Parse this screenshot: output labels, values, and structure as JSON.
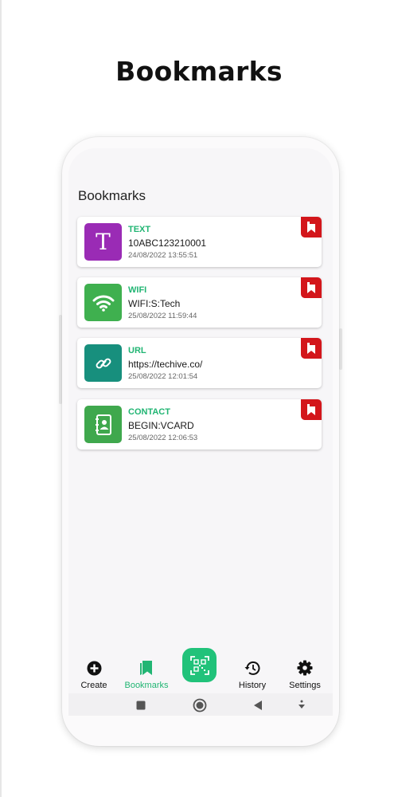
{
  "hero": {
    "title": "Bookmarks"
  },
  "screen": {
    "title": "Bookmarks"
  },
  "items": [
    {
      "type": "TEXT",
      "value": "10ABC123210001",
      "date": "24/08/2022 13:55:51",
      "icon": "text-t-icon",
      "color": "#9a2bb5"
    },
    {
      "type": "WIFI",
      "value": "WIFI:S:Tech",
      "date": "25/08/2022 11:59:44",
      "icon": "wifi-icon",
      "color": "#3fb04f"
    },
    {
      "type": "URL",
      "value": "https://techive.co/",
      "date": "25/08/2022 12:01:54",
      "icon": "link-icon",
      "color": "#178f7d"
    },
    {
      "type": "CONTACT",
      "value": "BEGIN:VCARD",
      "date": "25/08/2022 12:06:53",
      "icon": "contact-book-icon",
      "color": "#3fa84d"
    }
  ],
  "nav": {
    "create": "Create",
    "bookmarks": "Bookmarks",
    "history": "History",
    "settings": "Settings"
  },
  "colors": {
    "accent": "#21b573",
    "bookmark_red": "#d3161b"
  }
}
